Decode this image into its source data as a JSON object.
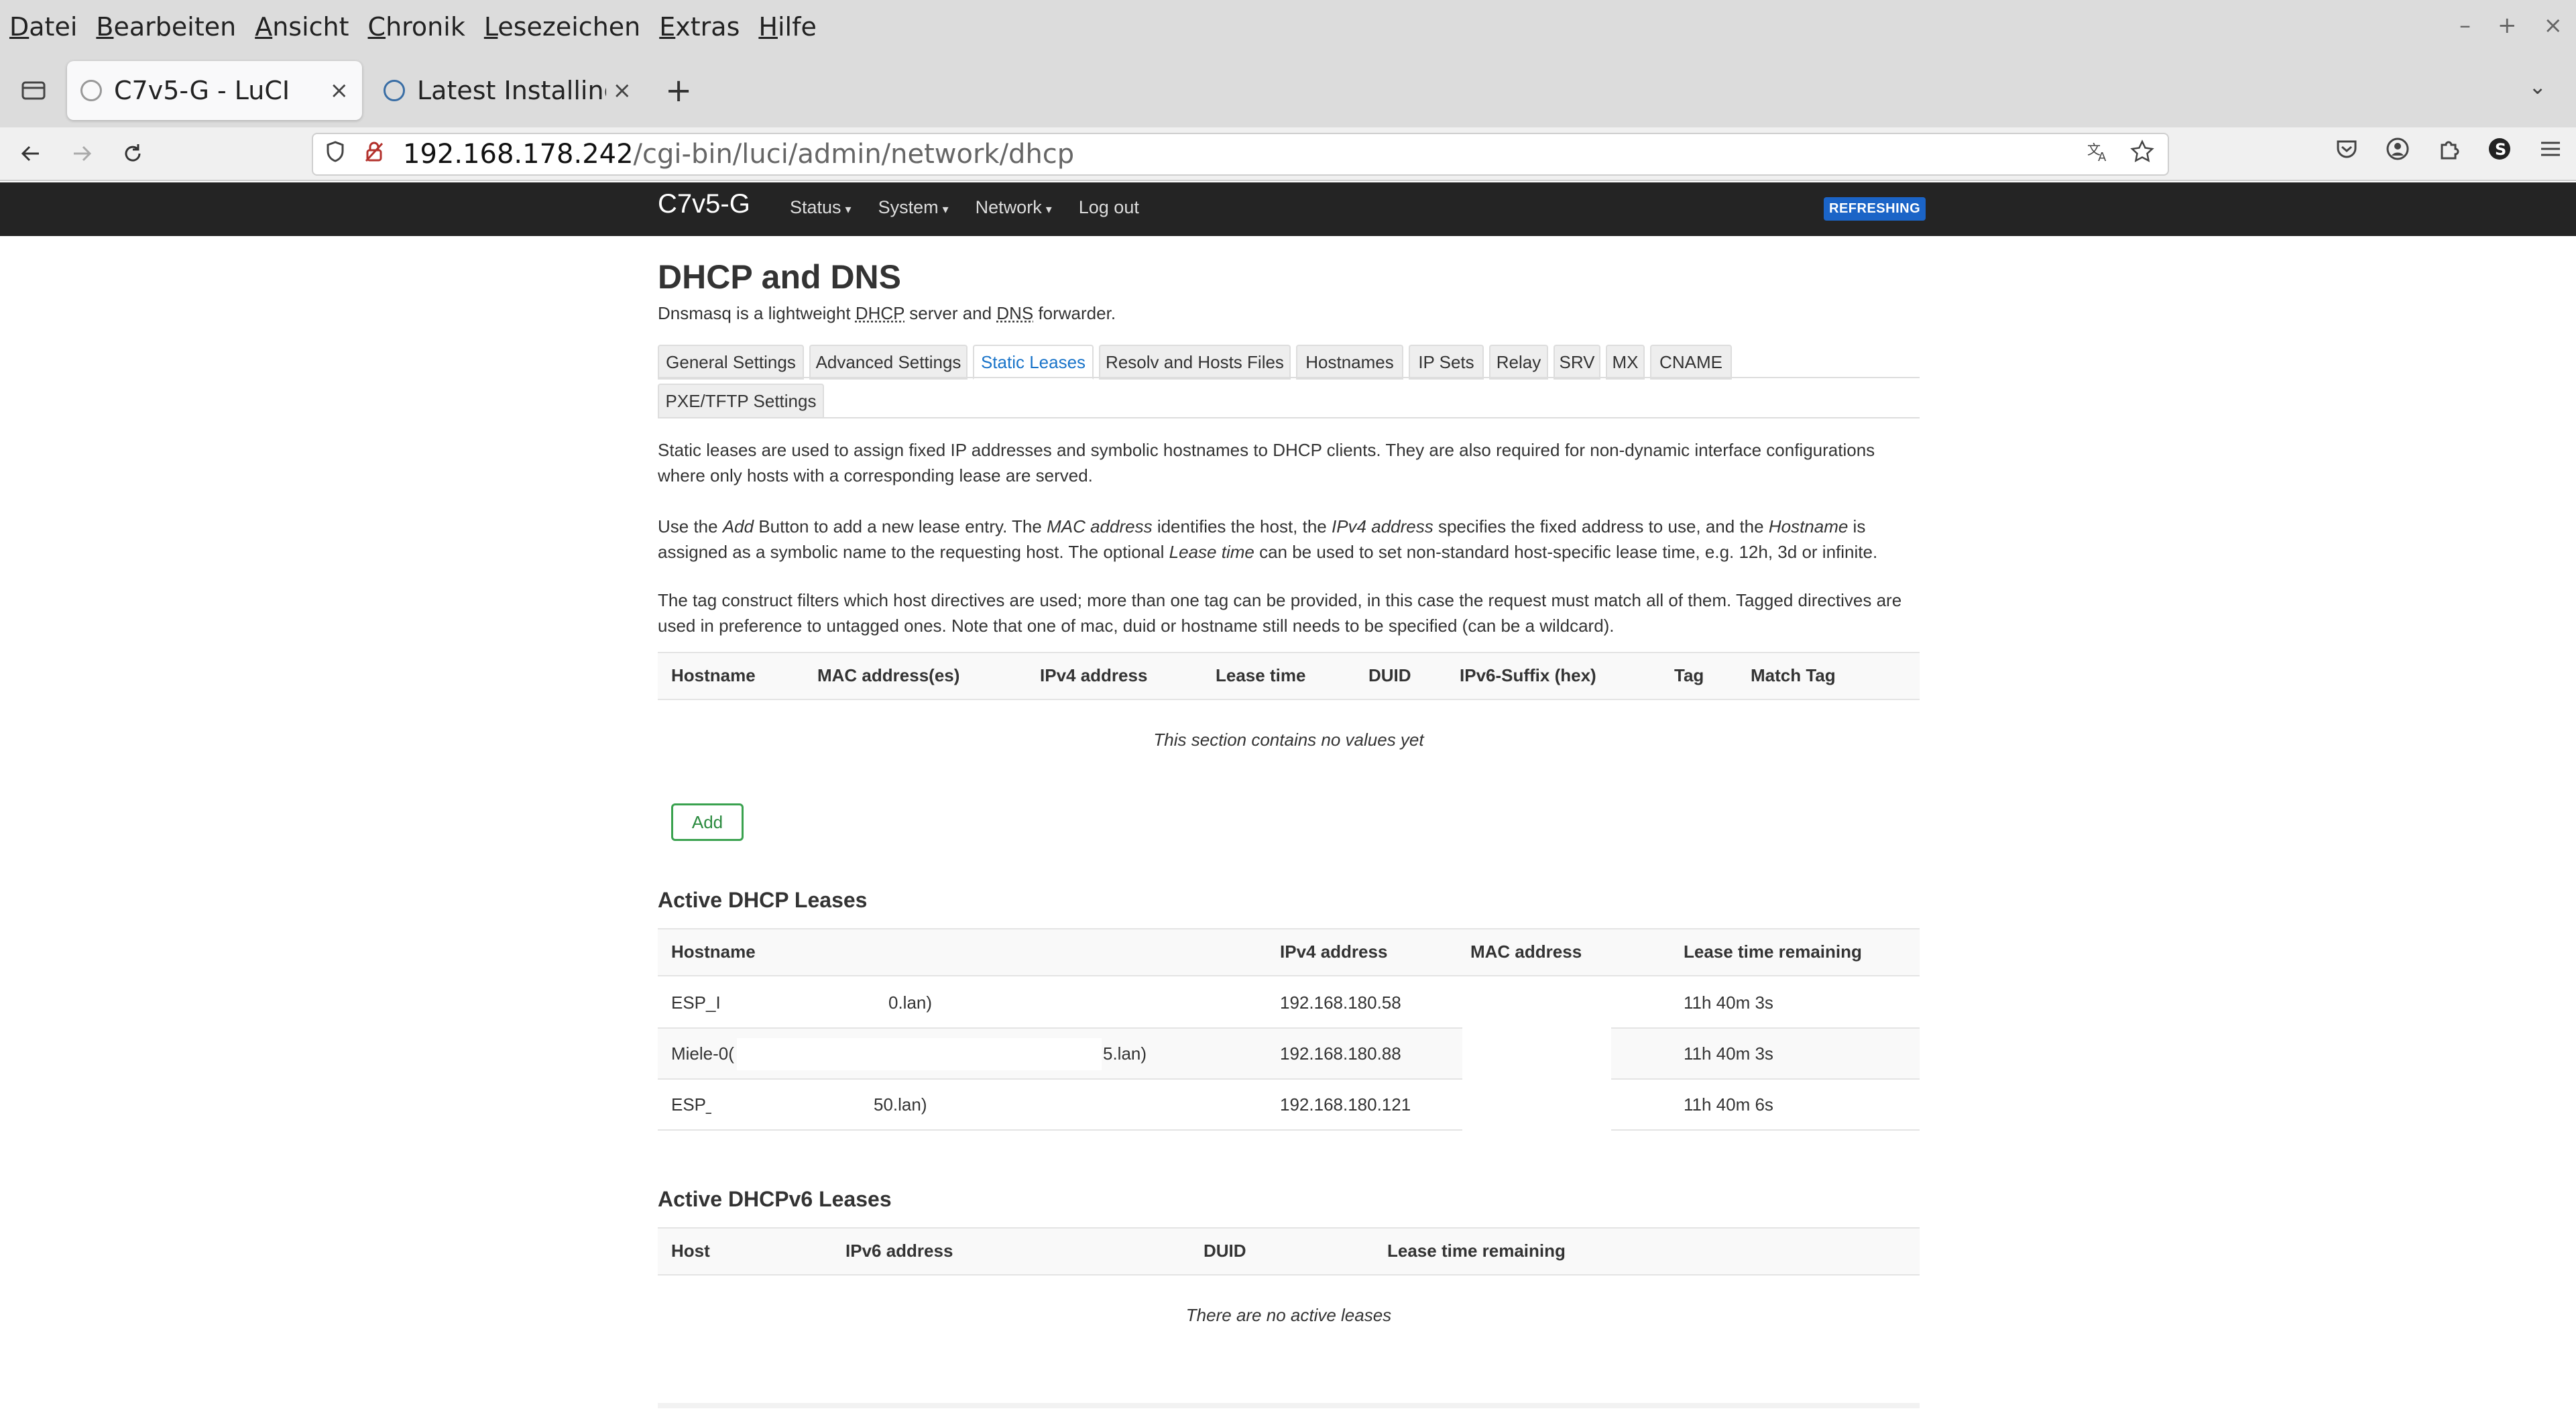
{
  "browser": {
    "menu": [
      {
        "first": "D",
        "rest": "atei"
      },
      {
        "first": "B",
        "rest": "earbeiten"
      },
      {
        "first": "A",
        "rest": "nsicht"
      },
      {
        "first": "C",
        "rest": "hronik"
      },
      {
        "first": "L",
        "rest": "esezeichen"
      },
      {
        "first": "E",
        "rest": "xtras"
      },
      {
        "first": "H",
        "rest": "ilfe"
      }
    ],
    "window_controls": [
      "–",
      "+",
      "×"
    ],
    "tabs": [
      {
        "label": "C7v5-G - LuCI",
        "close": "×"
      },
      {
        "label": "Latest Installing an",
        "close": "×"
      }
    ],
    "new_tab": "+",
    "tabs_dropdown": "⌄",
    "url_host": "192.168.178.242",
    "url_path": "/cgi-bin/luci/admin/network/dhcp"
  },
  "luci": {
    "brand": "C7v5-G",
    "menu": [
      "Status",
      "System",
      "Network",
      "Log out"
    ],
    "caret": "▾",
    "badge": "REFRESHING"
  },
  "page": {
    "title": "DHCP and DNS",
    "desc_before": "Dnsmasq is a lightweight ",
    "desc_abbr1": "DHCP",
    "desc_mid": " server and ",
    "desc_abbr2": "DNS",
    "desc_after": " forwarder.",
    "tabs": [
      "General Settings",
      "Advanced Settings",
      "Static Leases",
      "Resolv and Hosts Files",
      "Hostnames",
      "IP Sets",
      "Relay",
      "SRV",
      "MX",
      "CNAME",
      "PXE/TFTP Settings"
    ],
    "para1": "Static leases are used to assign fixed IP addresses and symbolic hostnames to DHCP clients. They are also required for non-dynamic interface configurations where only hosts with a corresponding lease are served.",
    "para2": {
      "a": "Use the ",
      "b": "Add",
      "c": " Button to add a new lease entry. The ",
      "d": "MAC address",
      "e": " identifies the host, the ",
      "f": "IPv4 address",
      "g": " specifies the fixed address to use, and the ",
      "h": "Hostname",
      "i": " is assigned as a symbolic name to the requesting host. The optional ",
      "j": "Lease time",
      "k": " can be used to set non-standard host-specific lease time, e.g. 12h, 3d or infinite."
    },
    "para3": "The tag construct filters which host directives are used; more than one tag can be provided, in this case the request must match all of them. Tagged directives are used in preference to untagged ones. Note that one of mac, duid or hostname still needs to be specified (can be a wildcard).",
    "static_headers": [
      "Hostname",
      "MAC address(es)",
      "IPv4 address",
      "Lease time",
      "DUID",
      "IPv6-Suffix (hex)",
      "Tag",
      "Match Tag"
    ],
    "static_empty": "This section contains no values yet",
    "add_label": "Add",
    "dhcp_title": "Active DHCP Leases",
    "dhcp_headers": [
      "Hostname",
      "IPv4 address",
      "MAC address",
      "Lease time remaining"
    ],
    "dhcp_rows": [
      {
        "host_start": "ESP_I",
        "host_end": "0.lan)",
        "ip": "192.168.180.58",
        "lease": "11h 40m 3s"
      },
      {
        "host_start": "Miele-0(",
        "host_end": "5.lan)",
        "ip": "192.168.180.88",
        "lease": "11h 40m 3s"
      },
      {
        "host_start": "ESP_",
        "host_end": "50.lan)",
        "ip": "192.168.180.121",
        "lease": "11h 40m 6s"
      }
    ],
    "dhcp6_title": "Active DHCPv6 Leases",
    "dhcp6_headers": [
      "Host",
      "IPv6 address",
      "DUID",
      "Lease time remaining"
    ],
    "dhcp6_empty": "There are no active leases"
  }
}
